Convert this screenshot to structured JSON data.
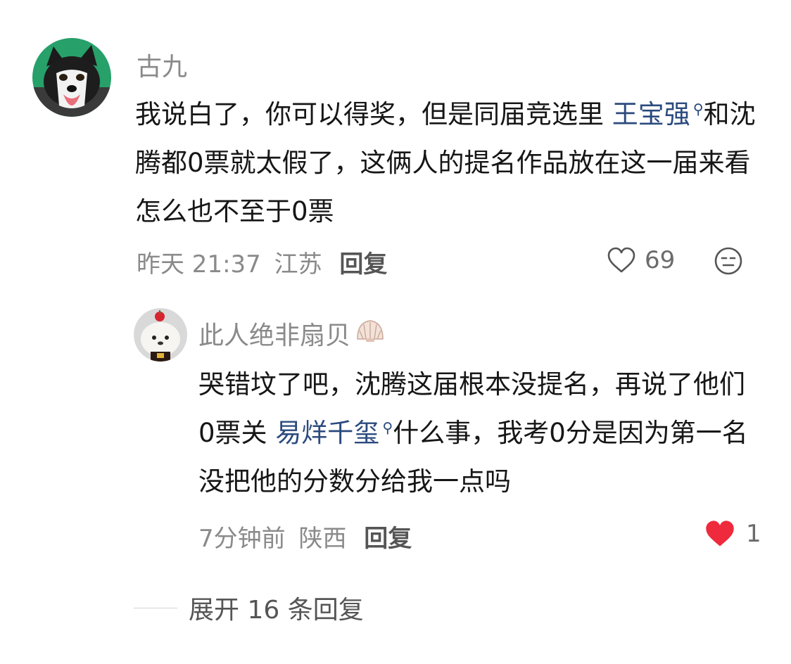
{
  "comment": {
    "username": "古九",
    "text_parts": {
      "before_link": "我说白了，你可以得奖，但是同届竞选里 ",
      "link": "王宝强",
      "after_link": "和沈腾都0票就太假了，这俩人的提名作品放在这一届来看怎么也不至于0票"
    },
    "time": "昨天 21:37",
    "location": "江苏",
    "reply_label": "回复",
    "likes": "69",
    "avatar_icon": "husky-dog-avatar"
  },
  "reply": {
    "username": "此人绝非扇贝",
    "badge_icon": "scallop-shell-icon",
    "text_parts": {
      "before_link": "哭错坟了吧，沈腾这届根本没提名，再说了他们0票关 ",
      "link": "易烊千玺",
      "after_link": "什么事，我考0分是因为第一名没把他的分数分给我一点吗"
    },
    "time": "7分钟前",
    "location": "陕西",
    "reply_label": "回复",
    "likes": "1",
    "liked": true,
    "like_color": "#ee2a3c",
    "avatar_icon": "cartoon-plush-avatar"
  },
  "expand": {
    "label": "展开 16 条回复"
  },
  "colors": {
    "link": "#2b4a7e",
    "muted": "#8a8a8a",
    "text": "#161616"
  }
}
